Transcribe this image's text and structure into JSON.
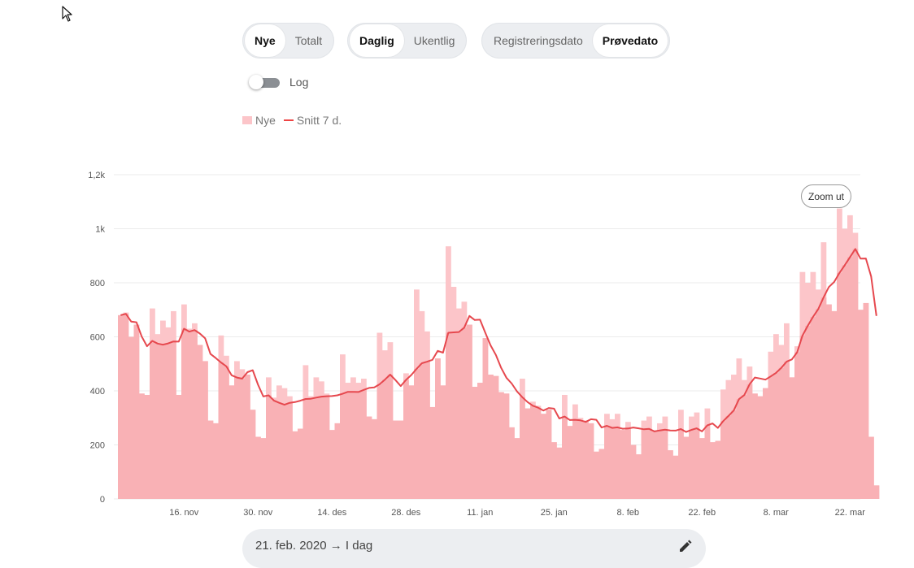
{
  "controls": {
    "measure": [
      "Nye",
      "Totalt"
    ],
    "period": [
      "Daglig",
      "Ukentlig"
    ],
    "dateType": [
      "Registreringsdato",
      "Prøvedato"
    ],
    "log_label": "Log",
    "log_enabled": false
  },
  "legend": {
    "bars": "Nye",
    "line": "Snitt 7 d."
  },
  "zoom_label": "Zoom ut",
  "date_range": "21. feb. 2020 → I dag",
  "colors": {
    "bar": "#fcc5c9",
    "bar_dark": "#f9b1b5",
    "line": "#e6484e",
    "grid": "#ebebeb",
    "active_text": "#111111"
  },
  "icons": {
    "cursor": "arrow-cursor-icon",
    "edit": "pencil-icon"
  },
  "chart_data": {
    "type": "bar",
    "series": [
      {
        "name": "Nye",
        "kind": "bar"
      },
      {
        "name": "Snitt 7 d.",
        "kind": "line"
      }
    ],
    "y_ticks": [
      "0",
      "200",
      "400",
      "600",
      "800",
      "1k",
      "1,2k"
    ],
    "ylim": [
      0,
      1200
    ],
    "x_ticks": [
      {
        "label": "16. nov",
        "index": 12
      },
      {
        "label": "30. nov",
        "index": 26
      },
      {
        "label": "14. des",
        "index": 40
      },
      {
        "label": "28. des",
        "index": 54
      },
      {
        "label": "11. jan",
        "index": 68
      },
      {
        "label": "25. jan",
        "index": 82
      },
      {
        "label": "8. feb",
        "index": 96
      },
      {
        "label": "22. feb",
        "index": 110
      },
      {
        "label": "8. mar",
        "index": 124
      },
      {
        "label": "22. mar",
        "index": 138
      }
    ],
    "x_first_date": "2020-11-04",
    "values": [
      680,
      690,
      600,
      645,
      390,
      385,
      705,
      610,
      660,
      635,
      695,
      385,
      720,
      630,
      650,
      570,
      510,
      290,
      280,
      605,
      530,
      420,
      510,
      480,
      460,
      330,
      230,
      225,
      450,
      375,
      420,
      410,
      380,
      250,
      260,
      495,
      380,
      450,
      435,
      390,
      255,
      280,
      535,
      430,
      450,
      430,
      445,
      305,
      295,
      615,
      550,
      580,
      290,
      290,
      465,
      420,
      775,
      695,
      620,
      340,
      520,
      420,
      935,
      785,
      705,
      730,
      645,
      415,
      430,
      595,
      460,
      455,
      395,
      390,
      265,
      225,
      445,
      335,
      360,
      345,
      315,
      330,
      210,
      190,
      385,
      270,
      350,
      300,
      290,
      280,
      175,
      185,
      315,
      295,
      315,
      255,
      285,
      200,
      165,
      290,
      305,
      250,
      280,
      305,
      180,
      160,
      330,
      230,
      305,
      320,
      225,
      335,
      210,
      215,
      405,
      440,
      460,
      520,
      440,
      490,
      390,
      380,
      410,
      545,
      610,
      570,
      650,
      450,
      565,
      840,
      800,
      840,
      775,
      950,
      720,
      695,
      1075,
      1000,
      1050,
      985,
      700,
      725,
      230,
      50
    ]
  }
}
